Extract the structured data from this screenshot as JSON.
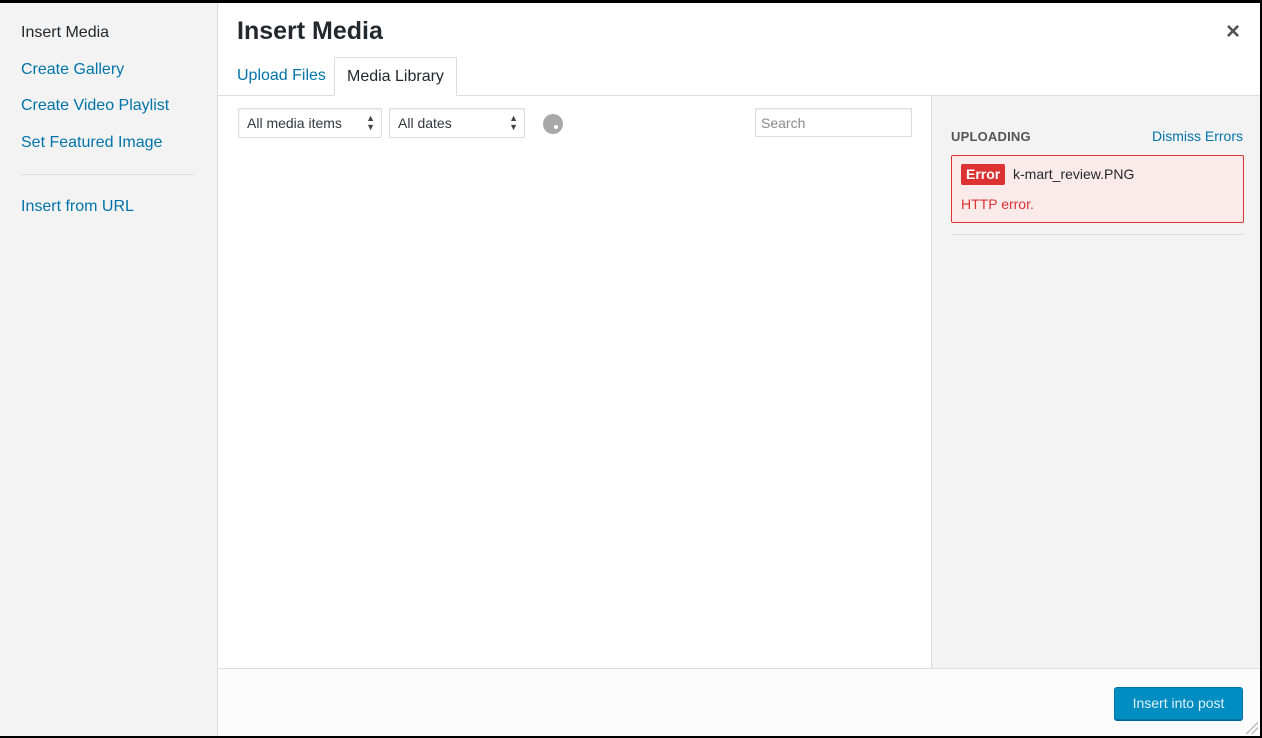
{
  "menu": {
    "items": [
      {
        "label": "Insert Media",
        "active": true
      },
      {
        "label": "Create Gallery"
      },
      {
        "label": "Create Video Playlist"
      },
      {
        "label": "Set Featured Image"
      },
      {
        "label": "Insert from URL"
      }
    ]
  },
  "header": {
    "title": "Insert Media",
    "close_glyph": "×"
  },
  "tabs": [
    {
      "label": "Upload Files"
    },
    {
      "label": "Media Library",
      "active": true
    }
  ],
  "toolbar": {
    "media_filter": {
      "selected": "All media items"
    },
    "date_filter": {
      "selected": "All dates"
    },
    "search": {
      "placeholder": "Search",
      "value": ""
    }
  },
  "uploading": {
    "title": "UPLOADING",
    "dismiss_label": "Dismiss Errors",
    "error": {
      "badge": "Error",
      "filename": "k-mart_review.PNG",
      "message": "HTTP error."
    }
  },
  "footer": {
    "insert_label": "Insert into post"
  },
  "colors": {
    "link": "#0073aa",
    "error": "#dc3232",
    "primary_button": "#008ec2"
  }
}
